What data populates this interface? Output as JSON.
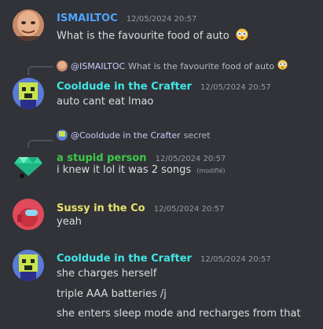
{
  "colors": {
    "background": "#313338",
    "user_blue": "#4fa3ff",
    "user_teal": "#41e6e6",
    "user_green": "#3ec94a",
    "user_yellow": "#e7e06c",
    "timestamp": "#949ba4",
    "text": "#dbdee1"
  },
  "messages": [
    {
      "author": "ISMAILTOC",
      "timestamp": "12/05/2024 20:57",
      "lines": [
        "What is the favourite food of auto"
      ],
      "emoji": "flushed-face-emoji"
    },
    {
      "reply": {
        "mention": "@ISMAILTOC",
        "text": "What is the favourite food of auto"
      },
      "author": "Cooldude in the Crafter",
      "timestamp": "12/05/2024 20:57",
      "lines": [
        "auto cant eat lmao"
      ]
    },
    {
      "reply": {
        "mention": "@Cooldude in the Crafter",
        "text": "secret"
      },
      "author": "a stupid person",
      "timestamp": "12/05/2024 20:57",
      "lines": [
        "i knew it lol it was 2 songs"
      ],
      "edited": "(modifié)"
    },
    {
      "author": "Sussy in the Co",
      "timestamp": "12/05/2024 20:57",
      "lines": [
        "yeah"
      ]
    },
    {
      "author": "Cooldude in the Crafter",
      "timestamp": "12/05/2024 20:57",
      "lines": [
        "she charges herself",
        "triple AAA batteries /j",
        "she enters sleep mode and recharges from that"
      ]
    }
  ]
}
